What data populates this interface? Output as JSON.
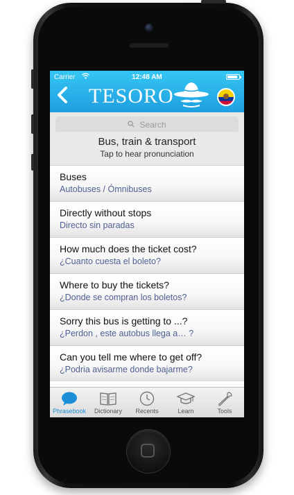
{
  "status_bar": {
    "carrier": "Carrier",
    "time": "12:48 AM",
    "battery_fraction": 0.85
  },
  "header": {
    "logo": "TESORO",
    "back_icon": "chevron-left-icon",
    "mascot_icon": "sombrero-mustache-icon",
    "flag_icon": "ecuador-flag-icon"
  },
  "search": {
    "placeholder": "Search"
  },
  "section": {
    "title": "Bus, train & transport",
    "subtitle": "Tap to hear pronunciation"
  },
  "phrases": [
    {
      "en": "Buses",
      "es": "Autobuses / Ómnibuses"
    },
    {
      "en": "Directly without stops",
      "es": "Directo sin paradas"
    },
    {
      "en": "How much does the ticket cost?",
      "es": "¿Cuanto cuesta el boleto?"
    },
    {
      "en": "Where to buy the tickets?",
      "es": "¿Donde se compran los boletos?"
    },
    {
      "en": "Sorry this bus is getting to ...?",
      "es": "¿Perdon , este autobus llega a… ?"
    },
    {
      "en": "Can you tell me where to get off?",
      "es": "¿Podria avisarme donde bajarme?"
    }
  ],
  "tabs": [
    {
      "label": "Phrasebook",
      "icon": "speech-bubble-icon",
      "active": true
    },
    {
      "label": "Dictionary",
      "icon": "book-icon",
      "active": false
    },
    {
      "label": "Recents",
      "icon": "clock-icon",
      "active": false
    },
    {
      "label": "Learn",
      "icon": "graduation-cap-icon",
      "active": false
    },
    {
      "label": "Tools",
      "icon": "wrench-icon",
      "active": false
    }
  ],
  "colors": {
    "header_top": "#35c6f3",
    "header_bottom": "#1f9fe0",
    "active_tab": "#1d8ed8",
    "translation_text": "#4e6090"
  }
}
